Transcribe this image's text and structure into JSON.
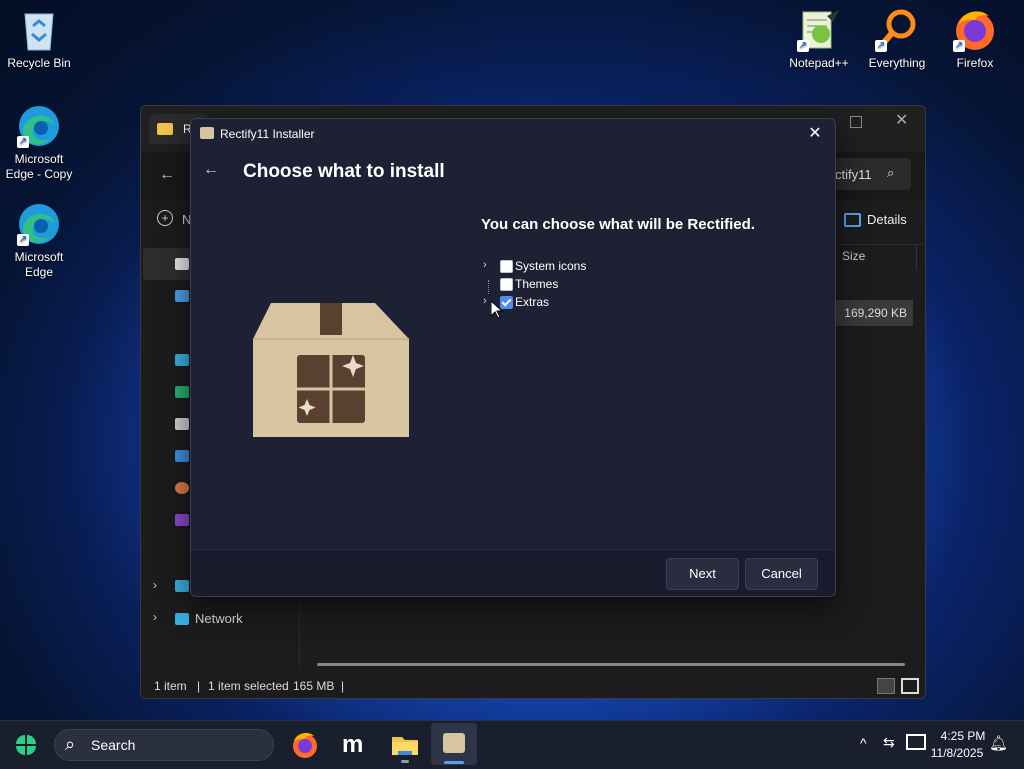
{
  "desktop": {
    "icons": [
      {
        "label": "Recycle Bin"
      },
      {
        "label": "Microsoft Edge - Copy"
      },
      {
        "label": "Microsoft Edge"
      },
      {
        "label": "Notepad++"
      },
      {
        "label": "Everything"
      },
      {
        "label": "Firefox"
      }
    ]
  },
  "explorer": {
    "tab_partial": "R",
    "new_partial": "N",
    "search_partial": "ctify11",
    "details_label": "Details",
    "col_size": "Size",
    "file_size": "169,290 KB",
    "nav_network": "Network",
    "status": {
      "count": "1 item",
      "selected": "1 item selected",
      "size": "165 MB"
    }
  },
  "dialog": {
    "title": "Rectify11 Installer",
    "heading": "Choose what to install",
    "subheading": "You can choose what will be Rectified.",
    "tree": [
      {
        "label": "System icons",
        "checked": false,
        "expandable": true
      },
      {
        "label": "Themes",
        "checked": false,
        "expandable": false
      },
      {
        "label": "Extras",
        "checked": true,
        "expandable": true
      }
    ],
    "next_label": "Next",
    "cancel_label": "Cancel"
  },
  "taskbar": {
    "search_placeholder": "Search",
    "time": "4:25 PM",
    "date": "11/8/2025"
  },
  "colors": {
    "dialog_bg": "#1e2033",
    "accent": "#4c8df0",
    "box": "#d7c4a1"
  }
}
